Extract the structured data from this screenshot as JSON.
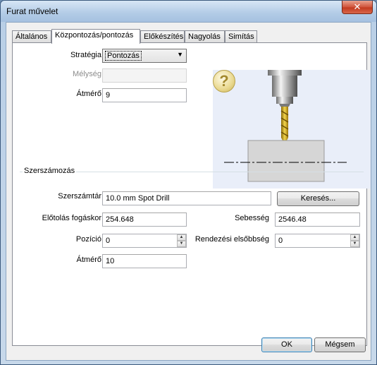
{
  "window": {
    "title": "Furat művelet",
    "close_label": "✕"
  },
  "tabs": [
    {
      "label": "Általános"
    },
    {
      "label": "Központozás/pontozás"
    },
    {
      "label": "Előkészítés"
    },
    {
      "label": "Nagyolás"
    },
    {
      "label": "Simítás"
    }
  ],
  "center": {
    "strategy_label": "Stratégia",
    "strategy_value": "Pontozás",
    "depth_label": "Mélység",
    "depth_value": "",
    "diameter_label": "Átmérő",
    "diameter_value": "9",
    "help_icon": "question-icon"
  },
  "tooling": {
    "group_label": "Szerszámozás",
    "library_label": "Szerszámtár",
    "library_value": "10.0 mm Spot Drill",
    "search_button": "Keresés...",
    "feed_label": "Előtolás fogáskor",
    "feed_value": "254.648",
    "speed_label": "Sebesség",
    "speed_value": "2546.48",
    "position_label": "Pozíció",
    "position_value": "0",
    "order_label": "Rendezési elsőbbség",
    "order_value": "0",
    "diameter_label": "Átmérő",
    "diameter_value": "10"
  },
  "footer": {
    "ok": "OK",
    "cancel": "Mégsem"
  },
  "colors": {
    "drill_gold": "#d4a514",
    "workpiece": "#d6d6d6",
    "picture_bg": "#e9eef9"
  }
}
